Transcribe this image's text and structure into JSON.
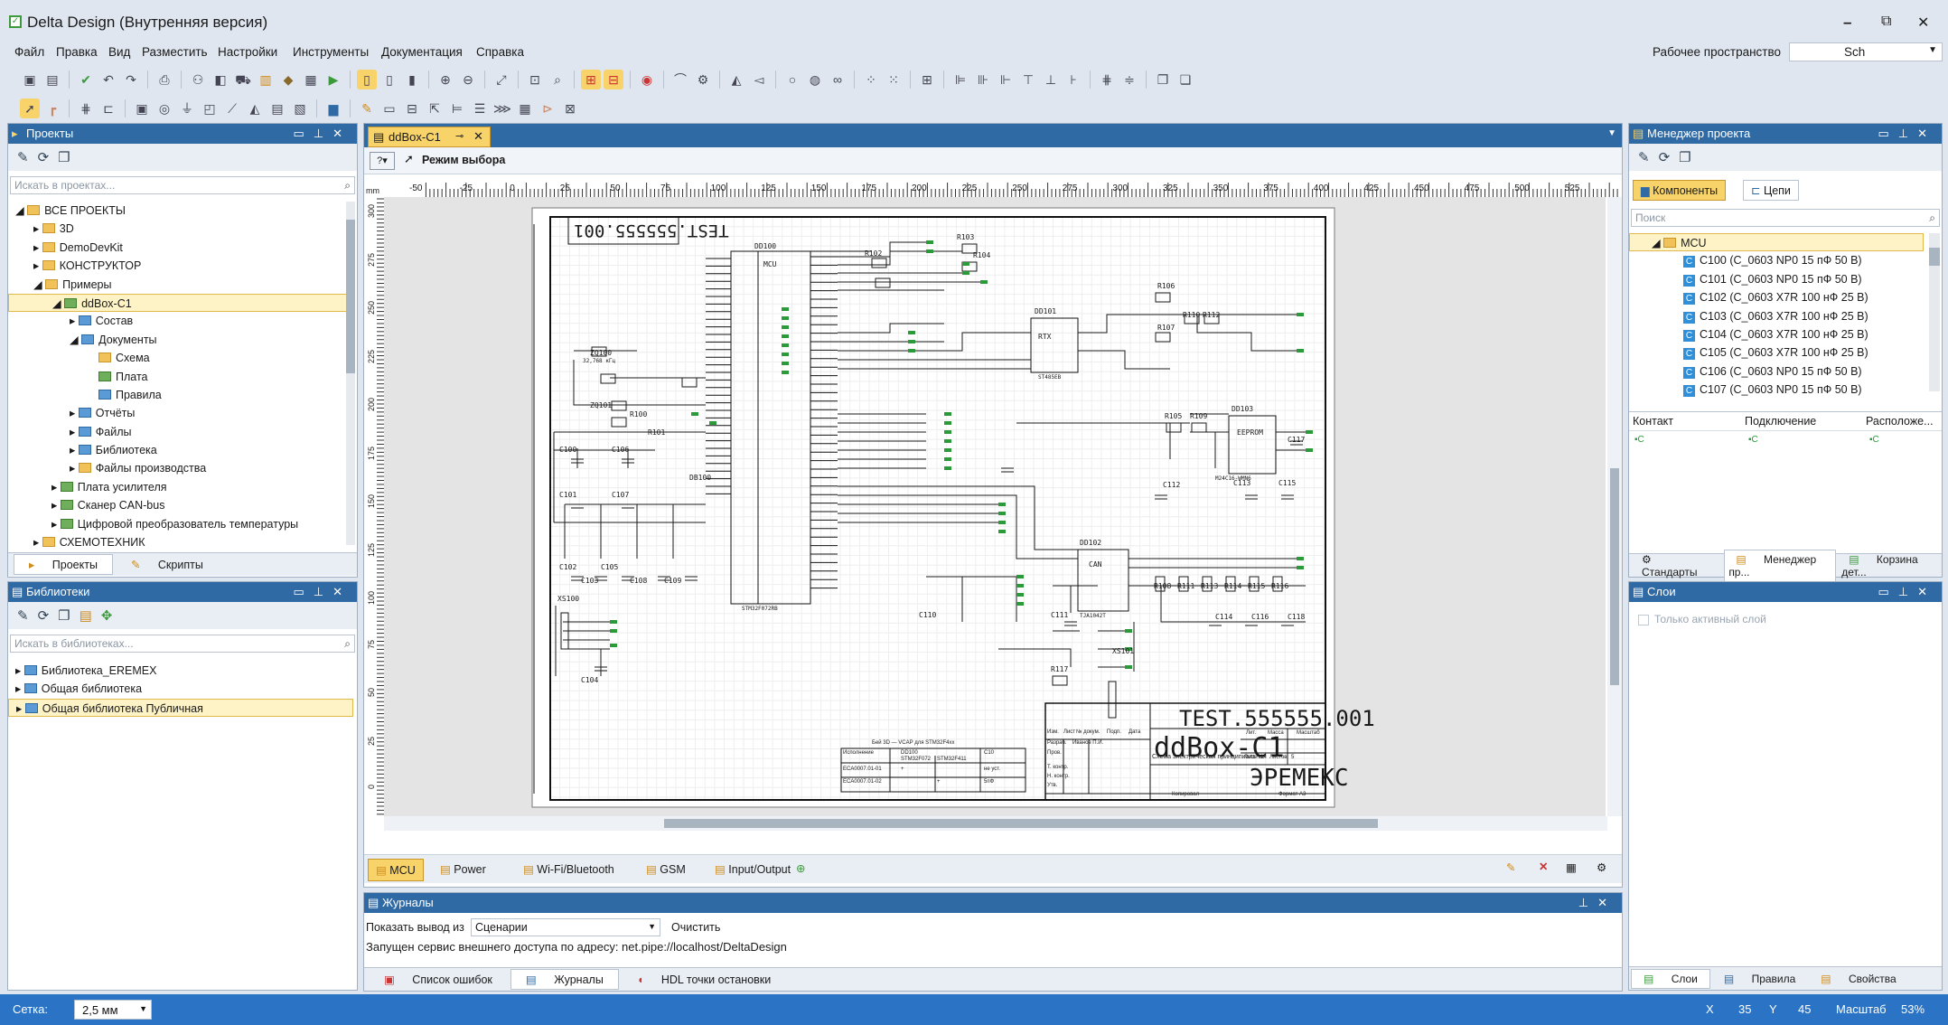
{
  "window": {
    "title": "Delta Design (Внутренняя версия)",
    "controls": [
      "–",
      "⧉",
      "✕"
    ]
  },
  "menu": [
    "Файл",
    "Правка",
    "Вид",
    "Разместить",
    "Настройки",
    "Инструменты",
    "Документация",
    "Справка"
  ],
  "workspace": {
    "label": "Рабочее пространство",
    "value": "Sch"
  },
  "projects_panel": {
    "title": "Проекты",
    "search_placeholder": "Искать в проектах...",
    "tree": [
      {
        "label": "ВСЕ ПРОЕКТЫ",
        "level": 0,
        "icon": "folder-icon"
      },
      {
        "label": "3D",
        "level": 1,
        "icon": "folder-icon"
      },
      {
        "label": "DemoDevKit",
        "level": 1,
        "icon": "folder-icon"
      },
      {
        "label": "КОНСТРУКТОР",
        "level": 1,
        "icon": "folder-icon"
      },
      {
        "label": "Примеры",
        "level": 1,
        "icon": "folder-icon"
      },
      {
        "label": "ddBox-C1",
        "level": 2,
        "icon": "project-icon",
        "selected": true
      },
      {
        "label": "Состав",
        "level": 3,
        "icon": "structure-icon"
      },
      {
        "label": "Документы",
        "level": 3,
        "icon": "documents-icon"
      },
      {
        "label": "Схема",
        "level": 4,
        "icon": "schematic-icon"
      },
      {
        "label": "Плата",
        "level": 4,
        "icon": "board-icon"
      },
      {
        "label": "Правила",
        "level": 4,
        "icon": "rules-icon"
      },
      {
        "label": "Отчёты",
        "level": 3,
        "icon": "reports-icon"
      },
      {
        "label": "Файлы",
        "level": 3,
        "icon": "files-icon"
      },
      {
        "label": "Библиотека",
        "level": 3,
        "icon": "library-icon"
      },
      {
        "label": "Файлы производства",
        "level": 3,
        "icon": "production-files-icon"
      },
      {
        "label": "Плата усилителя",
        "level": 2,
        "icon": "project-icon"
      },
      {
        "label": "Сканер CAN-bus",
        "level": 2,
        "icon": "project-icon"
      },
      {
        "label": "Цифровой преобразователь температуры",
        "level": 2,
        "icon": "project-icon"
      },
      {
        "label": "СХЕМОТЕХНИК",
        "level": 1,
        "icon": "folder-icon"
      }
    ],
    "tabs": [
      "Проекты",
      "Скрипты"
    ]
  },
  "libraries_panel": {
    "title": "Библиотеки",
    "search_placeholder": "Искать в библиотеках...",
    "items": [
      "Библиотека_EREMEX",
      "Общая библиотека",
      "Общая библиотека Публичная"
    ]
  },
  "document": {
    "tab_title": "ddBox-C1",
    "mode_label": "Режим выбора",
    "ruler_unit": "mm",
    "ruler_ticks": [
      "-50",
      "-25",
      "0",
      "25",
      "50",
      "75",
      "100",
      "125",
      "150",
      "175",
      "200",
      "225",
      "250",
      "275",
      "300",
      "325",
      "350",
      "375",
      "400",
      "425",
      "450",
      "475",
      "500",
      "525"
    ],
    "vruler_ticks": [
      "300",
      "275",
      "250",
      "225",
      "200",
      "175",
      "150",
      "125",
      "100",
      "75",
      "50",
      "25",
      "0"
    ],
    "sheet_tabs": [
      "MCU",
      "Power",
      "Wi-Fi/Bluetooth",
      "GSM",
      "Input/Output"
    ]
  },
  "schematic": {
    "doc_code_mirrored": "TEST.555555.001",
    "doc_code": "TEST.555555.001",
    "doc_name": "ddBox-C1",
    "doc_type": "Схема электрическая принципиальная",
    "company": "ЭРЕМЕКС",
    "copied": "Копировал",
    "format": "Формат A3",
    "stamp_headers": [
      "Лит.",
      "Масса",
      "Масштаб"
    ],
    "stamp_sheet": [
      "Лист",
      "1",
      "Листов",
      "5"
    ],
    "stamp_rows": [
      "Изм.",
      "Лист",
      "№ докум.",
      "Подп.",
      "Дата",
      "Разраб.",
      "Иванов П.И.",
      "Пров.",
      "Т. контр.",
      "Н. контр.",
      "Утв."
    ],
    "variant_table": {
      "caption": "Бей 3D — VCAP для STM32F4хх",
      "header": [
        "Исполнение",
        "DD100",
        "",
        "C10"
      ],
      "sub": [
        "",
        "STM32F072",
        "STM32F411",
        ""
      ],
      "rows": [
        [
          "ECA0007.01-01",
          "+",
          "",
          "не уст."
        ],
        [
          "ECA0007.01-02",
          "",
          "+",
          "5пФ"
        ]
      ]
    },
    "components": [
      "DD100",
      "MCU",
      "STM32F072RB",
      "ZQ100",
      "32,768 кГц",
      "ZQ101",
      "C100",
      "C101",
      "C102",
      "C103",
      "C104",
      "C105",
      "C106",
      "C107",
      "C108",
      "C109",
      "C110",
      "C111",
      "C112",
      "C113",
      "C114",
      "C115",
      "C116",
      "C117",
      "C118",
      "R100",
      "R101",
      "R102",
      "R103",
      "R104",
      "R105",
      "R106",
      "R107",
      "R108",
      "R109",
      "R110",
      "R111",
      "R112",
      "R113",
      "R114",
      "R115",
      "R116",
      "R117",
      "DD101",
      "RTX",
      "ST485EB",
      "DD102",
      "CAN",
      "TJA1042T",
      "DD103",
      "EEPROM",
      "M24C16-WMN6",
      "DB100",
      "XS100",
      "XS101"
    ]
  },
  "project_manager": {
    "title": "Менеджер проекта",
    "tabs": [
      "Компоненты",
      "Цепи"
    ],
    "search_placeholder": "Поиск",
    "group": "MCU",
    "items": [
      "C100 (C_0603 NP0 15 пФ 50 В)",
      "C101 (C_0603 NP0 15 пФ 50 В)",
      "C102 (C_0603 X7R 100 нФ 25 В)",
      "C103 (C_0603 X7R 100 нФ 25 В)",
      "C104 (C_0603 X7R 100 нФ 25 В)",
      "C105 (C_0603 X7R 100 нФ 25 В)",
      "C106 (C_0603 NP0 15 пФ 50 В)",
      "C107 (C_0603 NP0 15 пФ 50 В)"
    ],
    "columns": [
      "Контакт",
      "Подключение",
      "Расположе..."
    ],
    "col_values": [
      "С",
      "С",
      "С"
    ],
    "bottom_tabs": [
      "Стандарты",
      "Менеджер пр...",
      "Корзина дет..."
    ]
  },
  "layers_panel": {
    "title": "Слои",
    "checkbox_label": "Только активный слой",
    "tabs": [
      "Слои",
      "Правила",
      "Свойства"
    ]
  },
  "journal": {
    "title": "Журналы",
    "show_output_label": "Показать вывод из",
    "show_output_value": "Сценарии",
    "clear_label": "Очистить",
    "message": "Запущен сервис внешнего доступа по адресу: net.pipe://localhost/DeltaDesign",
    "tabs": [
      "Список ошибок",
      "Журналы",
      "HDL точки остановки"
    ]
  },
  "statusbar": {
    "grid_label": "Сетка:",
    "grid_value": "2,5 мм",
    "x_label": "X",
    "x_value": "35",
    "y_label": "Y",
    "y_value": "45",
    "scale_label": "Масштаб",
    "scale_value": "53%"
  }
}
